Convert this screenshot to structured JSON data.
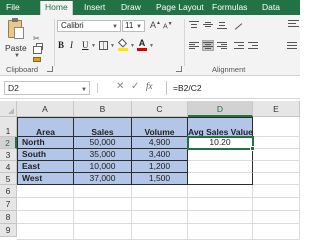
{
  "tabs": [
    {
      "label": "File",
      "active": false
    },
    {
      "label": "Home",
      "active": true
    },
    {
      "label": "Insert",
      "active": false
    },
    {
      "label": "Draw",
      "active": false
    },
    {
      "label": "Page Layout",
      "active": false
    },
    {
      "label": "Formulas",
      "active": false
    },
    {
      "label": "Data",
      "active": false
    }
  ],
  "ribbon": {
    "paste_label": "Paste",
    "clipboard_group": "Clipboard",
    "alignment_group": "Alignment",
    "font_name": "Calibri",
    "font_size": "11",
    "bold": "B",
    "italic": "I",
    "underline": "U",
    "font_color_glyph": "A"
  },
  "formula_bar": {
    "name_box": "D2",
    "formula": "=B2/C2"
  },
  "grid": {
    "columns": [
      "A",
      "B",
      "C",
      "D",
      "E"
    ],
    "rows": [
      "1",
      "2",
      "3",
      "4",
      "5",
      "6",
      "7",
      "8",
      "9"
    ],
    "active_cell": "D2",
    "headers": [
      "Area",
      "Sales",
      "Volume",
      "Avg Sales Value"
    ],
    "data": [
      {
        "area": "North",
        "sales": "50,000",
        "volume": "4,900",
        "avg": "10.20"
      },
      {
        "area": "South",
        "sales": "35,000",
        "volume": "3,400",
        "avg": ""
      },
      {
        "area": "East",
        "sales": "10,000",
        "volume": "1,200",
        "avg": ""
      },
      {
        "area": "West",
        "sales": "37,000",
        "volume": "1,500",
        "avg": ""
      }
    ]
  },
  "colors": {
    "accent": "#217346",
    "header_fill": "#b4c6e7"
  }
}
